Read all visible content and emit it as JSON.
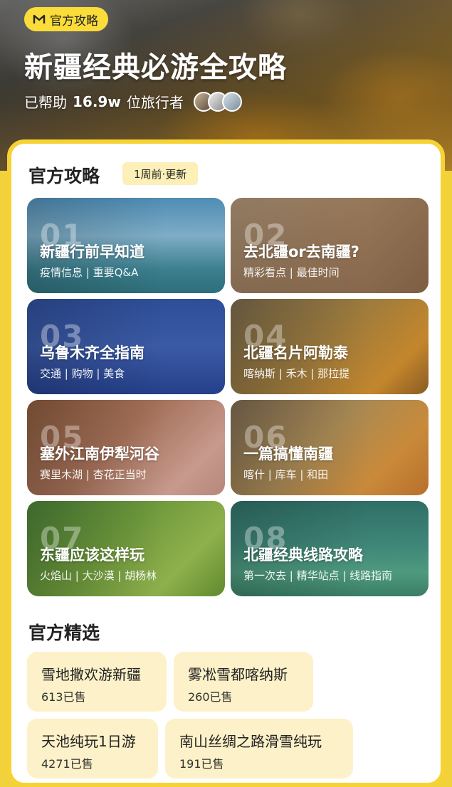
{
  "hero": {
    "badge_label": "官方攻略",
    "title": "新疆经典必游全攻略",
    "helped_prefix": "已帮助",
    "helped_count": "16.9w",
    "helped_suffix": "位旅行者"
  },
  "guides": {
    "title": "官方攻略",
    "update_label": "1周前·更新",
    "items": [
      {
        "num": "01",
        "title": "新疆行前早知道",
        "sub": "疫情信息 | 重要Q&A"
      },
      {
        "num": "02",
        "title": "去北疆or去南疆?",
        "sub": "精彩看点 | 最佳时间"
      },
      {
        "num": "03",
        "title": "乌鲁木齐全指南",
        "sub": "交通 | 购物 | 美食"
      },
      {
        "num": "04",
        "title": "北疆名片阿勒泰",
        "sub": "喀纳斯 | 禾木 | 那拉提"
      },
      {
        "num": "05",
        "title": "塞外江南伊犁河谷",
        "sub": "赛里木湖 | 杏花正当时"
      },
      {
        "num": "06",
        "title": "一篇搞懂南疆",
        "sub": "喀什 | 库车 | 和田"
      },
      {
        "num": "07",
        "title": "东疆应该这样玩",
        "sub": "火焰山 | 大沙漠 | 胡杨林"
      },
      {
        "num": "08",
        "title": "北疆经典线路攻略",
        "sub": "第一次去 | 精华站点 | 线路指南"
      }
    ]
  },
  "picks": {
    "title": "官方精选",
    "items": [
      {
        "name": "雪地撒欢游新疆",
        "sold": "613已售"
      },
      {
        "name": "雾凇雪都喀纳斯",
        "sold": "260已售"
      },
      {
        "name": "天池纯玩1日游",
        "sold": "4271已售"
      },
      {
        "name": "南山丝绸之路滑雪纯玩",
        "sold": "191已售"
      }
    ]
  },
  "colors": {
    "accent": "#f7d234",
    "pick_bg": "#fcf1c8",
    "pill_bg": "#fcefb7"
  }
}
